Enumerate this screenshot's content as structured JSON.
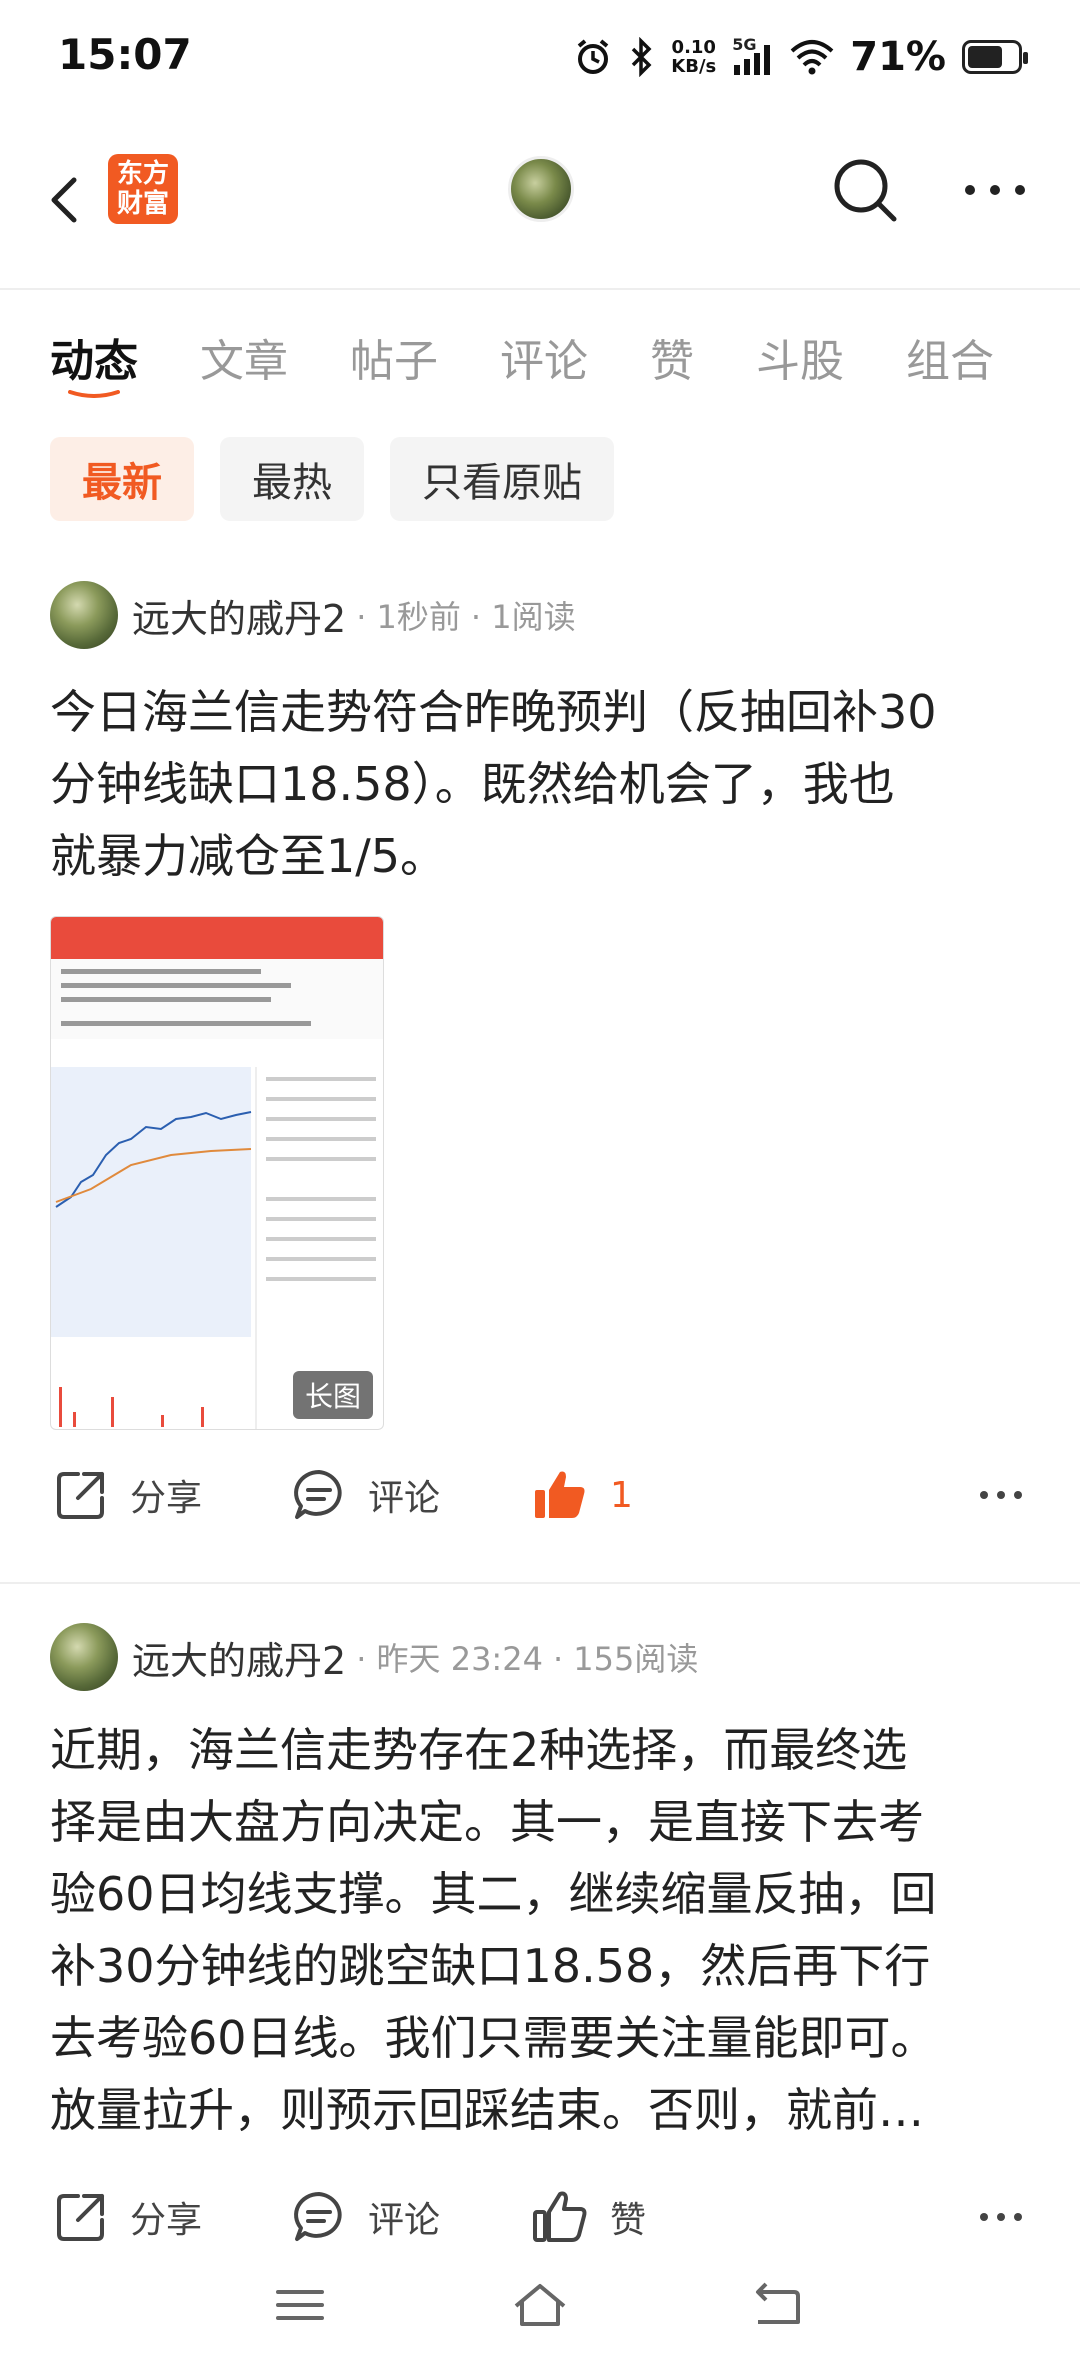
{
  "status_bar": {
    "time": "15:07",
    "net_speed_value": "0.10",
    "net_speed_unit": "KB/s",
    "network": "5G",
    "battery_text": "71%",
    "battery_level": 0.71
  },
  "nav": {
    "logo_line1": "东方",
    "logo_line2": "财富",
    "back_icon": "chevron-left-icon",
    "search_icon": "search-icon",
    "more_icon": "more-horizontal-icon"
  },
  "tabs": [
    {
      "label": "动态",
      "active": true
    },
    {
      "label": "文章"
    },
    {
      "label": "帖子"
    },
    {
      "label": "评论"
    },
    {
      "label": "赞"
    },
    {
      "label": "斗股"
    },
    {
      "label": "组合"
    }
  ],
  "filters": [
    {
      "label": "最新",
      "active": true
    },
    {
      "label": "最热"
    },
    {
      "label": "只看原贴"
    }
  ],
  "posts": [
    {
      "author": "远大的戚丹2",
      "time": "· 1秒前",
      "reads": "· 1阅读",
      "body_lines": [
        "今日海兰信走势符合昨晚预判（反抽回补30",
        "分钟线缺口18.58）。既然给机会了，我也",
        "就暴力减仓至1/5。"
      ],
      "image_badge": "长图",
      "share_label": "分享",
      "comment_label": "评论",
      "like_count": "1"
    },
    {
      "author": "远大的戚丹2",
      "time": "· 昨天 23:24",
      "reads": "· 155阅读",
      "body_lines": [
        "近期，海兰信走势存在2种选择，而最终选",
        "择是由大盘方向决定。其一，是直接下去考",
        "验60日均线支撑。其二，继续缩量反抽，回",
        "补30分钟线的跳空缺口18.58，然后再下行",
        "去考验60日线。我们只需要关注量能即可。",
        "放量拉升，则预示回踩结束。否则，就前…"
      ],
      "share_label": "分享",
      "comment_label": "评论",
      "like_label": "赞"
    }
  ],
  "colors": {
    "brand": "#f15a22",
    "text": "#222222",
    "muted": "#999999"
  }
}
